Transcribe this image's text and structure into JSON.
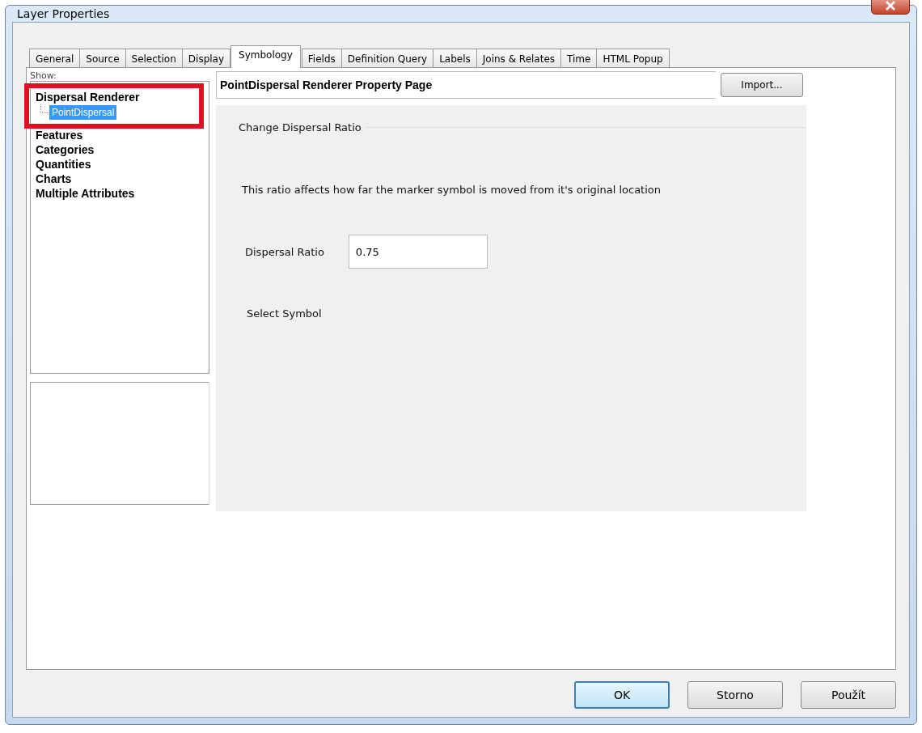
{
  "window": {
    "title": "Layer Properties"
  },
  "tabs": [
    {
      "label": "General",
      "selected": false
    },
    {
      "label": "Source",
      "selected": false
    },
    {
      "label": "Selection",
      "selected": false
    },
    {
      "label": "Display",
      "selected": false
    },
    {
      "label": "Symbology",
      "selected": true
    },
    {
      "label": "Fields",
      "selected": false
    },
    {
      "label": "Definition Query",
      "selected": false
    },
    {
      "label": "Labels",
      "selected": false
    },
    {
      "label": "Joins & Relates",
      "selected": false
    },
    {
      "label": "Time",
      "selected": false
    },
    {
      "label": "HTML Popup",
      "selected": false
    }
  ],
  "show": {
    "label": "Show:",
    "items": [
      {
        "label": "Dispersal Renderer",
        "children": [
          {
            "label": "PointDispersal",
            "selected": true
          }
        ]
      },
      {
        "label": "Features"
      },
      {
        "label": "Categories"
      },
      {
        "label": "Quantities"
      },
      {
        "label": "Charts"
      },
      {
        "label": "Multiple Attributes"
      }
    ]
  },
  "page": {
    "title": "PointDispersal Renderer Property Page",
    "import_button": "Import...",
    "group": "Change Dispersal Ratio",
    "description": "This ratio affects how far the marker symbol is moved from it's original location",
    "ratio_label": "Dispersal Ratio",
    "ratio_value": "0.75",
    "symbol_label": "Select Symbol"
  },
  "buttons": [
    {
      "label": "OK",
      "default": true
    },
    {
      "label": "Storno",
      "default": false
    },
    {
      "label": "Použít",
      "default": false
    }
  ]
}
